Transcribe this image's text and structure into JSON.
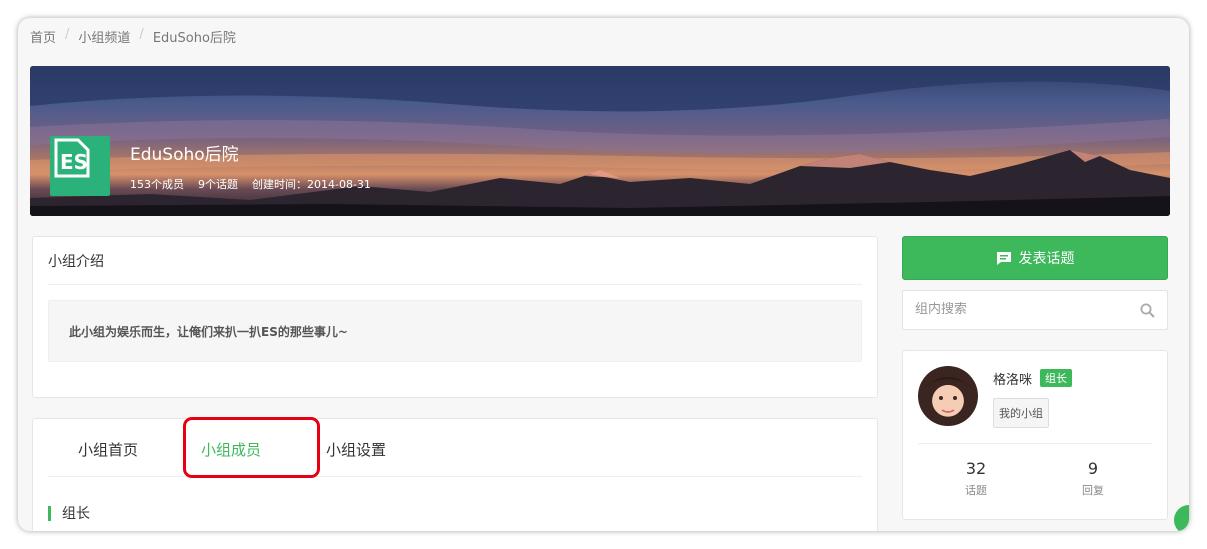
{
  "breadcrumb": {
    "items": [
      "首页",
      "小组频道",
      "EduSoho后院"
    ],
    "separator": "/"
  },
  "group": {
    "name": "EduSoho后院",
    "members": "153个成员",
    "topics": "9个话题",
    "created": "创建时间：2014-08-31",
    "logo_text": "ES"
  },
  "intro": {
    "title": "小组介绍",
    "text": "此小组为娱乐而生，让俺们来扒一扒ES的那些事儿~"
  },
  "tabs": {
    "home": "小组首页",
    "members": "小组成员",
    "settings": "小组设置",
    "active": "members"
  },
  "section": {
    "title": "组长"
  },
  "sidebar": {
    "post_button": "发表话题",
    "search_placeholder": "组内搜索",
    "owner": {
      "name": "格洛咪",
      "badge": "组长",
      "my_group_button": "我的小组",
      "topics_count": "32",
      "topics_label": "话题",
      "replies_count": "9",
      "replies_label": "回复"
    }
  },
  "colors": {
    "accent": "#3db85b",
    "highlight": "#e60012",
    "logo": "#2bb27a"
  },
  "icons": {
    "post": "chat-bubble-icon",
    "search": "magnifier-icon"
  }
}
